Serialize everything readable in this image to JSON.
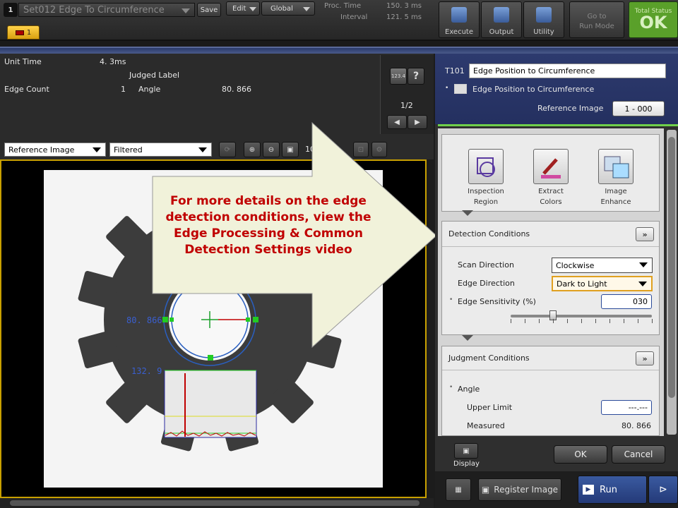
{
  "toolbar": {
    "setting_index": "1",
    "setting_name": "Set012  Edge To Circumference",
    "save_label": "Save",
    "edit_label": "Edit",
    "global_label": "Global",
    "proc_time_label": "Proc. Time",
    "proc_time_value": "150. 3  ms",
    "interval_label": "Interval",
    "interval_value": "121. 5  ms",
    "execute_label": "Execute",
    "output_label": "Output",
    "utility_label": "Utility",
    "run_mode_label": "Go to\nRun Mode",
    "total_status_label": "Total Status",
    "total_status_value": "OK",
    "camera_tab_label": "1"
  },
  "info": {
    "unit_time_label": "Unit Time",
    "unit_time_value": "4. 3ms",
    "judged_label_header": "Judged Label",
    "edge_count_label": "Edge Count",
    "edge_count_value": "1",
    "angle_label": "Angle",
    "angle_value": "80. 866",
    "numeric_button_label": "123.4",
    "help_label": "?",
    "page_indicator": "1/2"
  },
  "image_toolbar": {
    "image_select": "Reference Image",
    "filter_select": "Filtered",
    "zoom_label": "10"
  },
  "image_overlay": {
    "angle_label": "80. 866",
    "profile_label": "132. 9"
  },
  "callout": {
    "text": "For more details on the edge detection conditions, view the Edge Processing & Common Detection Settings video"
  },
  "right_panel": {
    "tool_id": "T101",
    "tool_name": "Edge Position to Circumference",
    "tool_type": "Edge Position to Circumference",
    "reference_image_label": "Reference Image",
    "reference_image_value": "1 - 000",
    "icons": [
      {
        "label": "Inspection\nRegion",
        "icon": "inspection-region-icon"
      },
      {
        "label": "Extract\nColors",
        "icon": "extract-colors-icon"
      },
      {
        "label": "Image\nEnhance",
        "icon": "image-enhance-icon"
      }
    ],
    "detection": {
      "title": "Detection Conditions",
      "scan_direction_label": "Scan Direction",
      "scan_direction_value": "Clockwise",
      "edge_direction_label": "Edge Direction",
      "edge_direction_value": "Dark to Light",
      "edge_sensitivity_label": "Edge Sensitivity (%)",
      "edge_sensitivity_value": "030",
      "edge_sensitivity_level": 0.3
    },
    "judgment": {
      "title": "Judgment Conditions",
      "angle_label": "Angle",
      "upper_limit_label": "Upper Limit",
      "upper_limit_value": "---.---",
      "measured_label": "Measured",
      "measured_value": "80. 866"
    },
    "display_label": "Display",
    "ok_label": "OK",
    "cancel_label": "Cancel"
  },
  "bottom": {
    "register_image_label": "Register Image",
    "run_label": "Run"
  }
}
